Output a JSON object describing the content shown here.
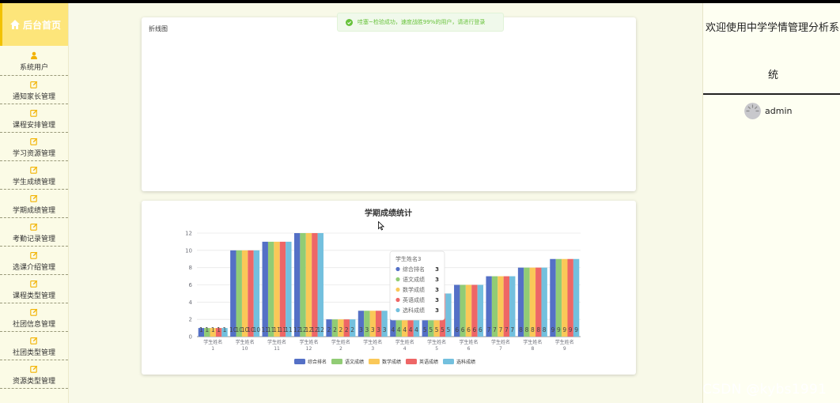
{
  "sidebar": {
    "home_label": "后台首页",
    "items": [
      {
        "label": "系统用户"
      },
      {
        "label": "通知家长管理"
      },
      {
        "label": "课程安排管理"
      },
      {
        "label": "学习资源管理"
      },
      {
        "label": "学生成绩管理"
      },
      {
        "label": "学期成绩管理"
      },
      {
        "label": "考勤记录管理"
      },
      {
        "label": "选课介绍管理"
      },
      {
        "label": "课程类型管理"
      },
      {
        "label": "社团信息管理"
      },
      {
        "label": "社团类型管理"
      },
      {
        "label": "资源类型管理"
      }
    ]
  },
  "toast": {
    "message": "哇塞~检验成功，速度战胜99%的用户，请进行登录"
  },
  "line_panel": {
    "title": "折线图"
  },
  "right_panel": {
    "welcome_line1": "欢迎使用中学学情管理分析系",
    "welcome_line2": "统",
    "username": "admin"
  },
  "watermark": "CSDN @kybs1991",
  "tooltip": {
    "title": "学生姓名3",
    "rows": [
      {
        "name": "综合排名",
        "value": "3"
      },
      {
        "name": "语文成绩",
        "value": "3"
      },
      {
        "name": "数学成绩",
        "value": "3"
      },
      {
        "name": "英语成绩",
        "value": "3"
      },
      {
        "name": "选科成绩",
        "value": "3"
      }
    ]
  },
  "chart_data": {
    "type": "bar",
    "title": "学期成绩统计",
    "categories": [
      "学生姓名\n1",
      "学生姓名\n10",
      "学生姓名\n11",
      "学生姓名\n12",
      "学生姓名\n2",
      "学生姓名\n3",
      "学生姓名\n4",
      "学生姓名\n5",
      "学生姓名\n6",
      "学生姓名\n7",
      "学生姓名\n8",
      "学生姓名\n9"
    ],
    "series": [
      {
        "name": "综合排名",
        "color": "#5470c6",
        "values": [
          1,
          10,
          11,
          12,
          2,
          3,
          4,
          5,
          6,
          7,
          8,
          9
        ]
      },
      {
        "name": "语文成绩",
        "color": "#91cc75",
        "values": [
          1,
          10,
          11,
          12,
          2,
          3,
          4,
          5,
          6,
          7,
          8,
          9
        ]
      },
      {
        "name": "数学成绩",
        "color": "#fac858",
        "values": [
          1,
          10,
          11,
          12,
          2,
          3,
          4,
          5,
          6,
          7,
          8,
          9
        ]
      },
      {
        "name": "英语成绩",
        "color": "#ee6666",
        "values": [
          1,
          10,
          11,
          12,
          2,
          3,
          4,
          5,
          6,
          7,
          8,
          9
        ]
      },
      {
        "name": "选科成绩",
        "color": "#73c0de",
        "values": [
          1,
          10,
          11,
          12,
          2,
          3,
          4,
          5,
          6,
          7,
          8,
          9
        ]
      }
    ],
    "ylim": [
      0,
      12
    ],
    "yticks": [
      "0",
      "2",
      "4",
      "6",
      "8",
      "10",
      "12"
    ],
    "grid": true,
    "legend": "bottom"
  }
}
